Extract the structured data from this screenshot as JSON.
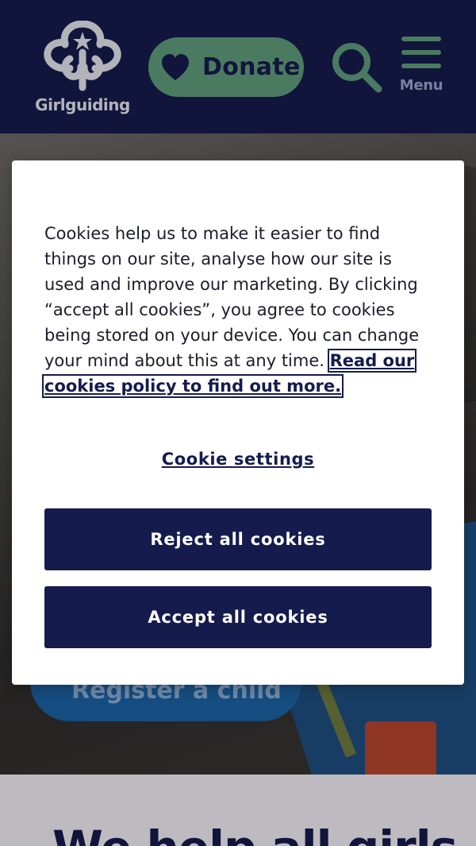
{
  "header": {
    "logo_text": "Girlguiding",
    "donate_label": "Donate",
    "menu_label": "Menu"
  },
  "hero": {
    "register_label": "Register a child"
  },
  "cookie_banner": {
    "text": "Cookies help us to make it easier to find things on our site, analyse how our site is used and improve our marketing. By clicking “accept all cookies”, you agree to cookies being stored on your device. You can change your mind about this at any time. ",
    "policy_link": "Read our cookies policy to find out more.",
    "settings_label": "Cookie settings",
    "reject_label": "Reject all cookies",
    "accept_label": "Accept all cookies"
  },
  "main": {
    "heading": "We help all girls"
  },
  "colors": {
    "navy": "#161b4e",
    "green": "#5f9e7d",
    "white": "#ffffff"
  },
  "icons": [
    "girlguiding-trefoil-icon",
    "heart-icon",
    "search-icon",
    "menu-icon"
  ]
}
